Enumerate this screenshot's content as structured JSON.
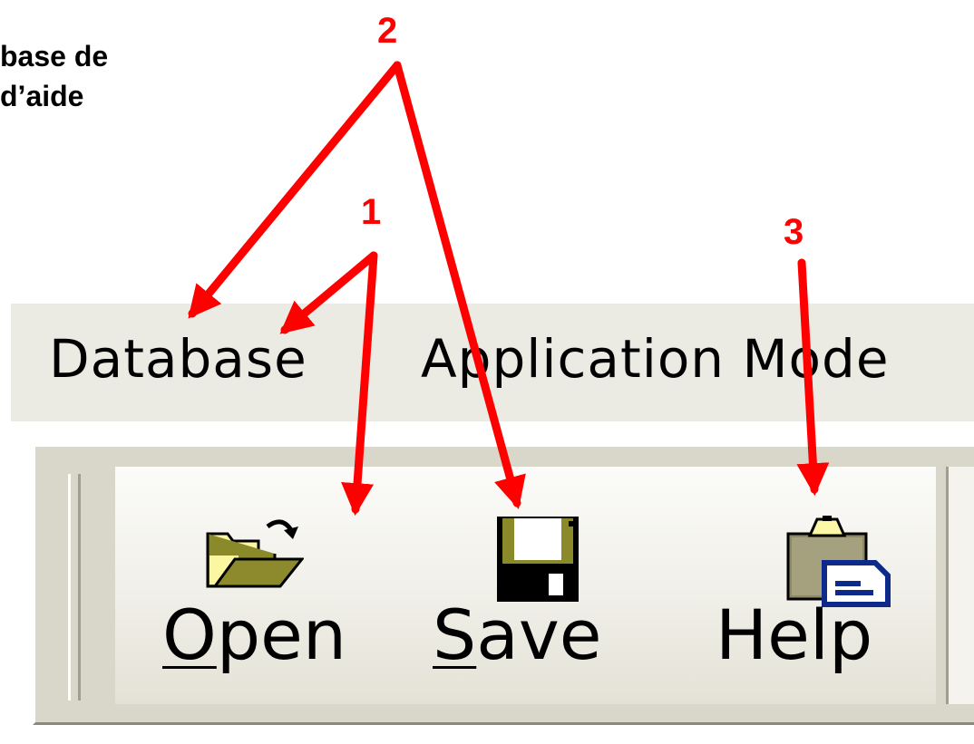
{
  "caption": {
    "line1": "base de",
    "line2": "d’aide"
  },
  "callouts": {
    "one": "1",
    "two": "2",
    "three": "3"
  },
  "menu": {
    "items": [
      "Database",
      "Application Mode"
    ]
  },
  "toolbar": {
    "buttons": [
      {
        "label_first": "O",
        "label_rest": "pen",
        "icon": "open-folder-icon"
      },
      {
        "label_first": "S",
        "label_rest": "ave",
        "icon": "floppy-disk-icon"
      },
      {
        "label_first": "",
        "label_rest": "Help",
        "icon": "clipboard-help-icon"
      }
    ]
  },
  "colors": {
    "arrow": "#ff0000",
    "menubar": "#ecebe3",
    "toolbar": "#d9d7c9"
  }
}
